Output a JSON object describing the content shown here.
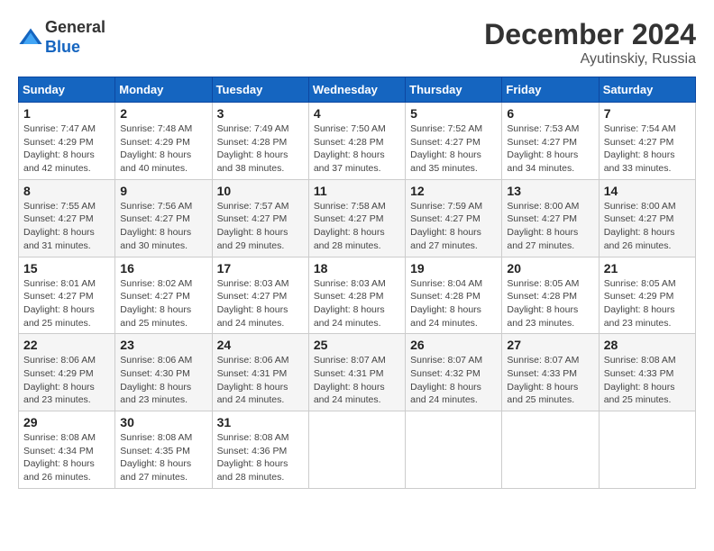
{
  "header": {
    "logo_line1": "General",
    "logo_line2": "Blue",
    "month": "December 2024",
    "location": "Ayutinskiy, Russia"
  },
  "weekdays": [
    "Sunday",
    "Monday",
    "Tuesday",
    "Wednesday",
    "Thursday",
    "Friday",
    "Saturday"
  ],
  "weeks": [
    [
      {
        "day": "1",
        "sunrise": "Sunrise: 7:47 AM",
        "sunset": "Sunset: 4:29 PM",
        "daylight": "Daylight: 8 hours and 42 minutes."
      },
      {
        "day": "2",
        "sunrise": "Sunrise: 7:48 AM",
        "sunset": "Sunset: 4:29 PM",
        "daylight": "Daylight: 8 hours and 40 minutes."
      },
      {
        "day": "3",
        "sunrise": "Sunrise: 7:49 AM",
        "sunset": "Sunset: 4:28 PM",
        "daylight": "Daylight: 8 hours and 38 minutes."
      },
      {
        "day": "4",
        "sunrise": "Sunrise: 7:50 AM",
        "sunset": "Sunset: 4:28 PM",
        "daylight": "Daylight: 8 hours and 37 minutes."
      },
      {
        "day": "5",
        "sunrise": "Sunrise: 7:52 AM",
        "sunset": "Sunset: 4:27 PM",
        "daylight": "Daylight: 8 hours and 35 minutes."
      },
      {
        "day": "6",
        "sunrise": "Sunrise: 7:53 AM",
        "sunset": "Sunset: 4:27 PM",
        "daylight": "Daylight: 8 hours and 34 minutes."
      },
      {
        "day": "7",
        "sunrise": "Sunrise: 7:54 AM",
        "sunset": "Sunset: 4:27 PM",
        "daylight": "Daylight: 8 hours and 33 minutes."
      }
    ],
    [
      {
        "day": "8",
        "sunrise": "Sunrise: 7:55 AM",
        "sunset": "Sunset: 4:27 PM",
        "daylight": "Daylight: 8 hours and 31 minutes."
      },
      {
        "day": "9",
        "sunrise": "Sunrise: 7:56 AM",
        "sunset": "Sunset: 4:27 PM",
        "daylight": "Daylight: 8 hours and 30 minutes."
      },
      {
        "day": "10",
        "sunrise": "Sunrise: 7:57 AM",
        "sunset": "Sunset: 4:27 PM",
        "daylight": "Daylight: 8 hours and 29 minutes."
      },
      {
        "day": "11",
        "sunrise": "Sunrise: 7:58 AM",
        "sunset": "Sunset: 4:27 PM",
        "daylight": "Daylight: 8 hours and 28 minutes."
      },
      {
        "day": "12",
        "sunrise": "Sunrise: 7:59 AM",
        "sunset": "Sunset: 4:27 PM",
        "daylight": "Daylight: 8 hours and 27 minutes."
      },
      {
        "day": "13",
        "sunrise": "Sunrise: 8:00 AM",
        "sunset": "Sunset: 4:27 PM",
        "daylight": "Daylight: 8 hours and 27 minutes."
      },
      {
        "day": "14",
        "sunrise": "Sunrise: 8:00 AM",
        "sunset": "Sunset: 4:27 PM",
        "daylight": "Daylight: 8 hours and 26 minutes."
      }
    ],
    [
      {
        "day": "15",
        "sunrise": "Sunrise: 8:01 AM",
        "sunset": "Sunset: 4:27 PM",
        "daylight": "Daylight: 8 hours and 25 minutes."
      },
      {
        "day": "16",
        "sunrise": "Sunrise: 8:02 AM",
        "sunset": "Sunset: 4:27 PM",
        "daylight": "Daylight: 8 hours and 25 minutes."
      },
      {
        "day": "17",
        "sunrise": "Sunrise: 8:03 AM",
        "sunset": "Sunset: 4:27 PM",
        "daylight": "Daylight: 8 hours and 24 minutes."
      },
      {
        "day": "18",
        "sunrise": "Sunrise: 8:03 AM",
        "sunset": "Sunset: 4:28 PM",
        "daylight": "Daylight: 8 hours and 24 minutes."
      },
      {
        "day": "19",
        "sunrise": "Sunrise: 8:04 AM",
        "sunset": "Sunset: 4:28 PM",
        "daylight": "Daylight: 8 hours and 24 minutes."
      },
      {
        "day": "20",
        "sunrise": "Sunrise: 8:05 AM",
        "sunset": "Sunset: 4:28 PM",
        "daylight": "Daylight: 8 hours and 23 minutes."
      },
      {
        "day": "21",
        "sunrise": "Sunrise: 8:05 AM",
        "sunset": "Sunset: 4:29 PM",
        "daylight": "Daylight: 8 hours and 23 minutes."
      }
    ],
    [
      {
        "day": "22",
        "sunrise": "Sunrise: 8:06 AM",
        "sunset": "Sunset: 4:29 PM",
        "daylight": "Daylight: 8 hours and 23 minutes."
      },
      {
        "day": "23",
        "sunrise": "Sunrise: 8:06 AM",
        "sunset": "Sunset: 4:30 PM",
        "daylight": "Daylight: 8 hours and 23 minutes."
      },
      {
        "day": "24",
        "sunrise": "Sunrise: 8:06 AM",
        "sunset": "Sunset: 4:31 PM",
        "daylight": "Daylight: 8 hours and 24 minutes."
      },
      {
        "day": "25",
        "sunrise": "Sunrise: 8:07 AM",
        "sunset": "Sunset: 4:31 PM",
        "daylight": "Daylight: 8 hours and 24 minutes."
      },
      {
        "day": "26",
        "sunrise": "Sunrise: 8:07 AM",
        "sunset": "Sunset: 4:32 PM",
        "daylight": "Daylight: 8 hours and 24 minutes."
      },
      {
        "day": "27",
        "sunrise": "Sunrise: 8:07 AM",
        "sunset": "Sunset: 4:33 PM",
        "daylight": "Daylight: 8 hours and 25 minutes."
      },
      {
        "day": "28",
        "sunrise": "Sunrise: 8:08 AM",
        "sunset": "Sunset: 4:33 PM",
        "daylight": "Daylight: 8 hours and 25 minutes."
      }
    ],
    [
      {
        "day": "29",
        "sunrise": "Sunrise: 8:08 AM",
        "sunset": "Sunset: 4:34 PM",
        "daylight": "Daylight: 8 hours and 26 minutes."
      },
      {
        "day": "30",
        "sunrise": "Sunrise: 8:08 AM",
        "sunset": "Sunset: 4:35 PM",
        "daylight": "Daylight: 8 hours and 27 minutes."
      },
      {
        "day": "31",
        "sunrise": "Sunrise: 8:08 AM",
        "sunset": "Sunset: 4:36 PM",
        "daylight": "Daylight: 8 hours and 28 minutes."
      },
      null,
      null,
      null,
      null
    ]
  ]
}
